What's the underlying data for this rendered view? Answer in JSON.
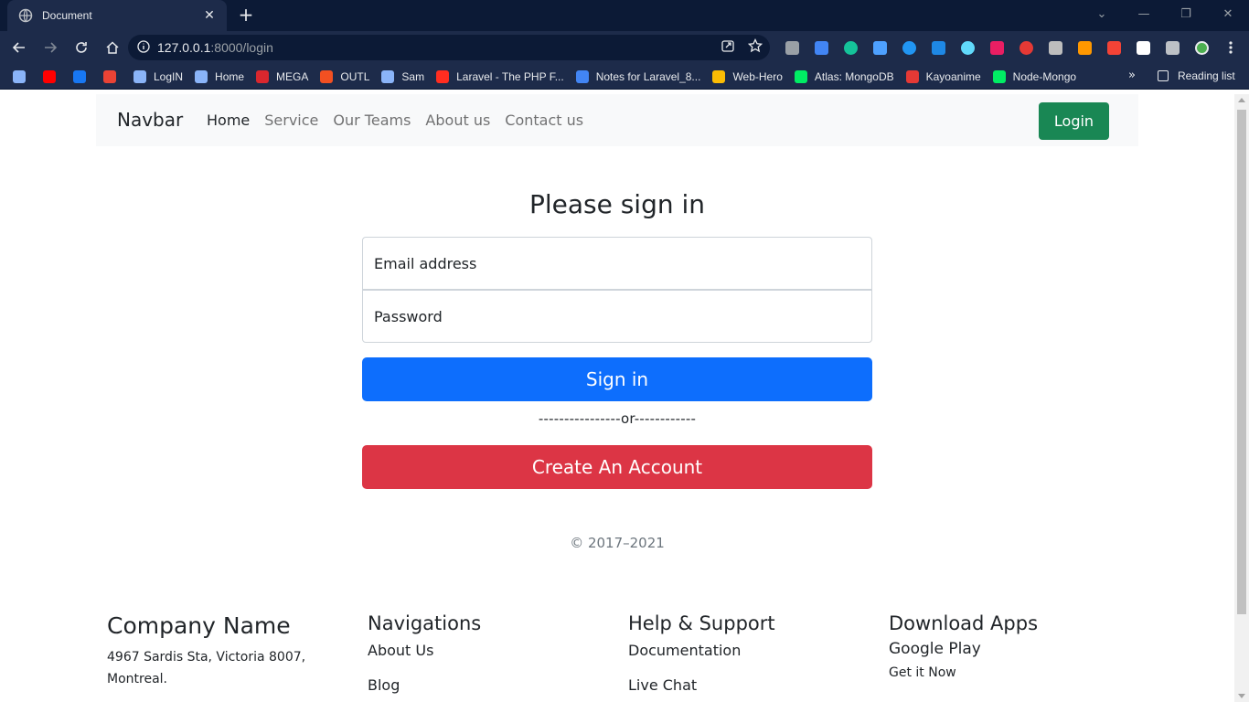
{
  "browser": {
    "tab_title": "Document",
    "tab_close": "✕",
    "new_tab": "+",
    "url_host": "127.0.0.1",
    "url_rest": ":8000/login",
    "bookmarks": [
      {
        "label": "",
        "color": "#8ab4f8"
      },
      {
        "label": "",
        "color": "#ff0000"
      },
      {
        "label": "",
        "color": "#1877f2"
      },
      {
        "label": "",
        "color": "#ea4335"
      },
      {
        "label": "LogIN",
        "color": "#8ab4f8"
      },
      {
        "label": "Home",
        "color": "#8ab4f8"
      },
      {
        "label": "MEGA",
        "color": "#d9272e"
      },
      {
        "label": "OUTL",
        "color": "#f25022"
      },
      {
        "label": "Sam",
        "color": "#8ab4f8"
      },
      {
        "label": "Laravel - The PHP F...",
        "color": "#ff2d20"
      },
      {
        "label": "Notes for Laravel_8...",
        "color": "#4285f4"
      },
      {
        "label": "Web-Hero",
        "color": "#fbbc04"
      },
      {
        "label": "Atlas: MongoDB",
        "color": "#00ed64"
      },
      {
        "label": "Kayoanime",
        "color": "#e53935"
      },
      {
        "label": "Node-Mongo",
        "color": "#00ed64"
      }
    ],
    "bookmarks_more": "»",
    "reading_list": "Reading list"
  },
  "navbar": {
    "brand": "Navbar",
    "links": [
      "Home",
      "Service",
      "Our Teams",
      "About us",
      "Contact us"
    ],
    "login": "Login"
  },
  "form": {
    "title": "Please sign in",
    "email_placeholder": "Email address",
    "password_placeholder": "Password",
    "signin": "Sign in",
    "divider": "----------------or------------",
    "create": "Create An Account",
    "copyright": "© 2017–2021"
  },
  "footer": {
    "company": "Company Name",
    "address_line1": "4967 Sardis Sta, Victoria 8007,",
    "address_line2": "Montreal.",
    "nav_title": "Navigations",
    "nav_links": [
      "About Us",
      "Blog"
    ],
    "help_title": "Help & Support",
    "help_links": [
      "Documentation",
      "Live Chat"
    ],
    "apps_title": "Download Apps",
    "apps_links": [
      "Google Play",
      "Get it Now"
    ]
  }
}
